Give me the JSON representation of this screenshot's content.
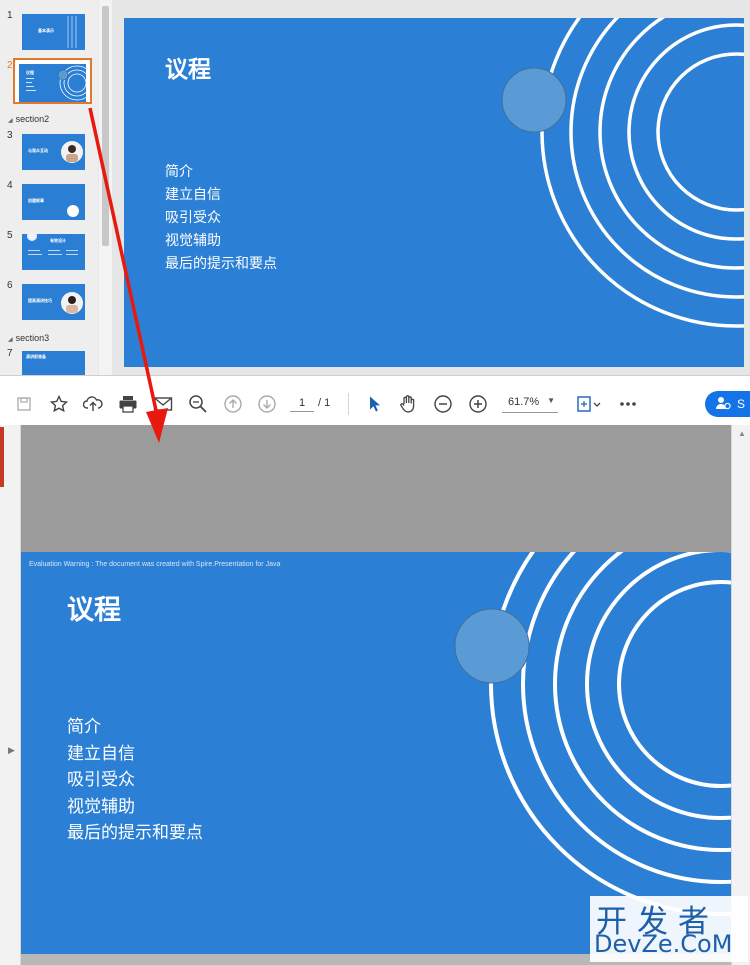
{
  "ppt": {
    "thumbnails": [
      {
        "num": "1",
        "title": "基本演示"
      },
      {
        "num": "2",
        "title": "议程",
        "selected": true
      },
      {
        "num": "3",
        "title": "与观众互动"
      },
      {
        "num": "4",
        "title": "创建叙事"
      },
      {
        "num": "5",
        "title": "有效设计"
      },
      {
        "num": "6",
        "title": "提高演讲技巧"
      },
      {
        "num": "7",
        "title": "演讲前准备"
      }
    ],
    "sections": [
      "section2",
      "section3"
    ],
    "slide": {
      "title": "议程",
      "items": [
        "简介",
        "建立自信",
        "吸引受众",
        "视觉辅助",
        "最后的提示和要点"
      ]
    }
  },
  "pdf": {
    "toolbar": {
      "page_current": "1",
      "page_total": "/ 1",
      "zoom": "61.7%",
      "share_label": "S",
      "icons": [
        "save-icon",
        "star-icon",
        "upload-icon",
        "print-icon",
        "mail-icon",
        "zoom-search-icon",
        "prev-page-icon",
        "next-page-icon",
        "select-cursor-icon",
        "hand-icon",
        "zoom-out-icon",
        "zoom-in-icon",
        "fit-page-icon",
        "more-icon"
      ]
    },
    "eval_warning": "Evaluation Warning : The document was created with  Spire.Presentation for Java",
    "slide": {
      "title": "议程",
      "items": [
        "简介",
        "建立自信",
        "吸引受众",
        "视觉辅助",
        "最后的提示和要点"
      ]
    }
  },
  "watermark": {
    "cn": "开发者",
    "en": "DevZe.CoM"
  },
  "colors": {
    "slide_blue": "#2b80d6",
    "circle_fill": "#5b9bd5",
    "selection_orange": "#e07a2a",
    "arrow_red": "#e8190f",
    "share_blue": "#1473e6"
  }
}
